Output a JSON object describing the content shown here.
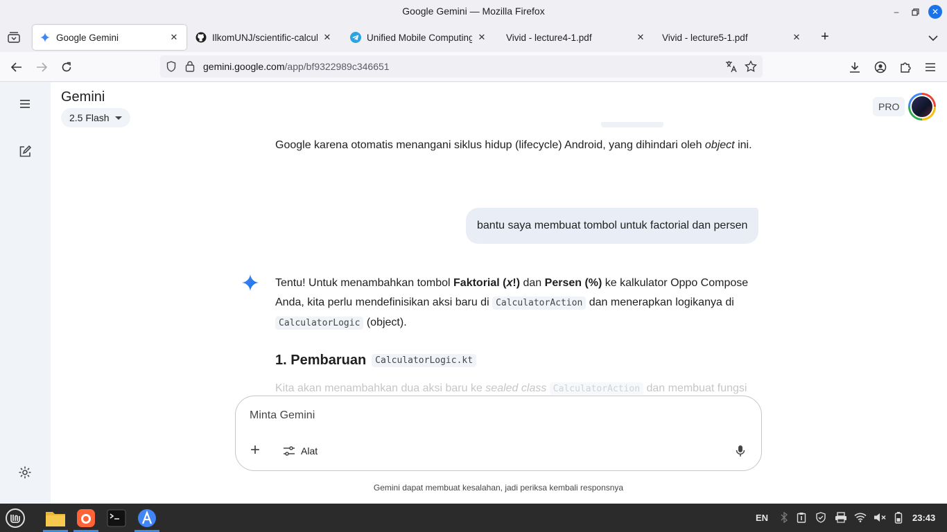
{
  "window": {
    "title": "Google Gemini — Mozilla Firefox"
  },
  "tabs": [
    {
      "label": "Google Gemini",
      "icon": "gemini-icon",
      "active": true
    },
    {
      "label": "IlkomUNJ/scientific-calculator",
      "icon": "github-icon"
    },
    {
      "label": "Unified Mobile Computing C",
      "icon": "telegram-icon"
    },
    {
      "label": "Vivid - lecture4-1.pdf",
      "icon": ""
    },
    {
      "label": "Vivid - lecture5-1.pdf",
      "icon": ""
    }
  ],
  "address": {
    "host": "gemini.google.com",
    "path": "/app/bf9322989c346651"
  },
  "app": {
    "brand": "Gemini",
    "model": "2.5 Flash",
    "pro_badge": "PRO"
  },
  "chat": {
    "prev_tail_a": "Google karena otomatis menangani siklus hidup (lifecycle) Android, yang dihindari oleh ",
    "prev_tail_em": "object",
    "prev_tail_b": " ini.",
    "user_message": "bantu saya membuat tombol untuk factorial dan persen",
    "reply": {
      "p1_a": "Tentu! Untuk menambahkan tombol ",
      "p1_b1": "Faktorial (𝑥!)",
      "p1_c": " dan ",
      "p1_b2": "Persen (%)",
      "p1_d": " ke kalkulator Oppo Compose Anda, kita perlu mendefinisikan aksi baru di ",
      "p1_code1": "CalculatorAction",
      "p1_e": " dan menerapkan logikanya di ",
      "p1_code2": "CalculatorLogic",
      "p1_f": " (object).",
      "heading": "1. Pembaruan",
      "heading_code": "CalculatorLogic.kt",
      "p2_a": "Kita akan menambahkan dua aksi baru ke ",
      "p2_em": "sealed class",
      "p2_code": "CalculatorAction",
      "p2_b": " dan membuat fungsi"
    }
  },
  "composer": {
    "placeholder": "Minta Gemini",
    "tools_label": "Alat"
  },
  "disclaimer": "Gemini dapat membuat kesalahan, jadi periksa kembali responsnya",
  "taskbar": {
    "lang": "EN",
    "time": "23:43"
  },
  "colors": {
    "accent": "#1a73e8",
    "user_bubble": "#e9eef6",
    "rail": "#f0f4f9"
  }
}
